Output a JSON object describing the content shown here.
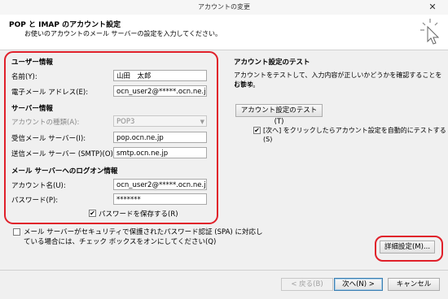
{
  "window": {
    "title": "アカウントの変更",
    "close_glyph": "✕"
  },
  "header": {
    "title": "POP と IMAP のアカウント設定",
    "subtitle": "お使いのアカウントのメール サーバーの設定を入力してください。"
  },
  "user_info": {
    "heading": "ユーザー情報",
    "name_label": "名前(Y):",
    "name_value": "山田　太郎",
    "email_label": "電子メール アドレス(E):",
    "email_value": "ocn_user2@*****.ocn.ne.jp"
  },
  "server_info": {
    "heading": "サーバー情報",
    "account_type_label": "アカウントの種類(A):",
    "account_type_value": "POP3",
    "incoming_label": "受信メール サーバー(I):",
    "incoming_value": "pop.ocn.ne.jp",
    "outgoing_label": "送信メール サーバー (SMTP)(O):",
    "outgoing_value": "smtp.ocn.ne.jp"
  },
  "logon_info": {
    "heading": "メール サーバーへのログオン情報",
    "account_name_label": "アカウント名(U):",
    "account_name_value": "ocn_user2@*****.ocn.ne.jp",
    "password_label": "パスワード(P):",
    "password_value": "*******",
    "remember_password_label": "パスワードを保存する(R)"
  },
  "spa": {
    "label_line1": "メール サーバーがセキュリティで保護されたパスワード認証 (SPA) に対応し",
    "label_line2": "ている場合には、チェック ボックスをオンにしてください(Q)"
  },
  "test_settings": {
    "heading": "アカウント設定のテスト",
    "desc_line1": "アカウントをテストして、入力内容が正しいかどうかを確認することをお勧め",
    "desc_line2": "します。",
    "test_button": "アカウント設定のテスト(T)",
    "auto_test_line1": "[次へ] をクリックしたらアカウント設定を自動的にテストする",
    "auto_test_line2": "(S)"
  },
  "buttons": {
    "more_settings": "詳細設定(M)...",
    "back": "< 戻る(B)",
    "next": "次へ(N) >",
    "cancel": "キャンセル"
  },
  "checkbox_states": {
    "remember_password": true,
    "spa": false,
    "auto_test": true
  },
  "check_glyph": "✔",
  "colors": {
    "highlight_red": "#e0202a"
  }
}
